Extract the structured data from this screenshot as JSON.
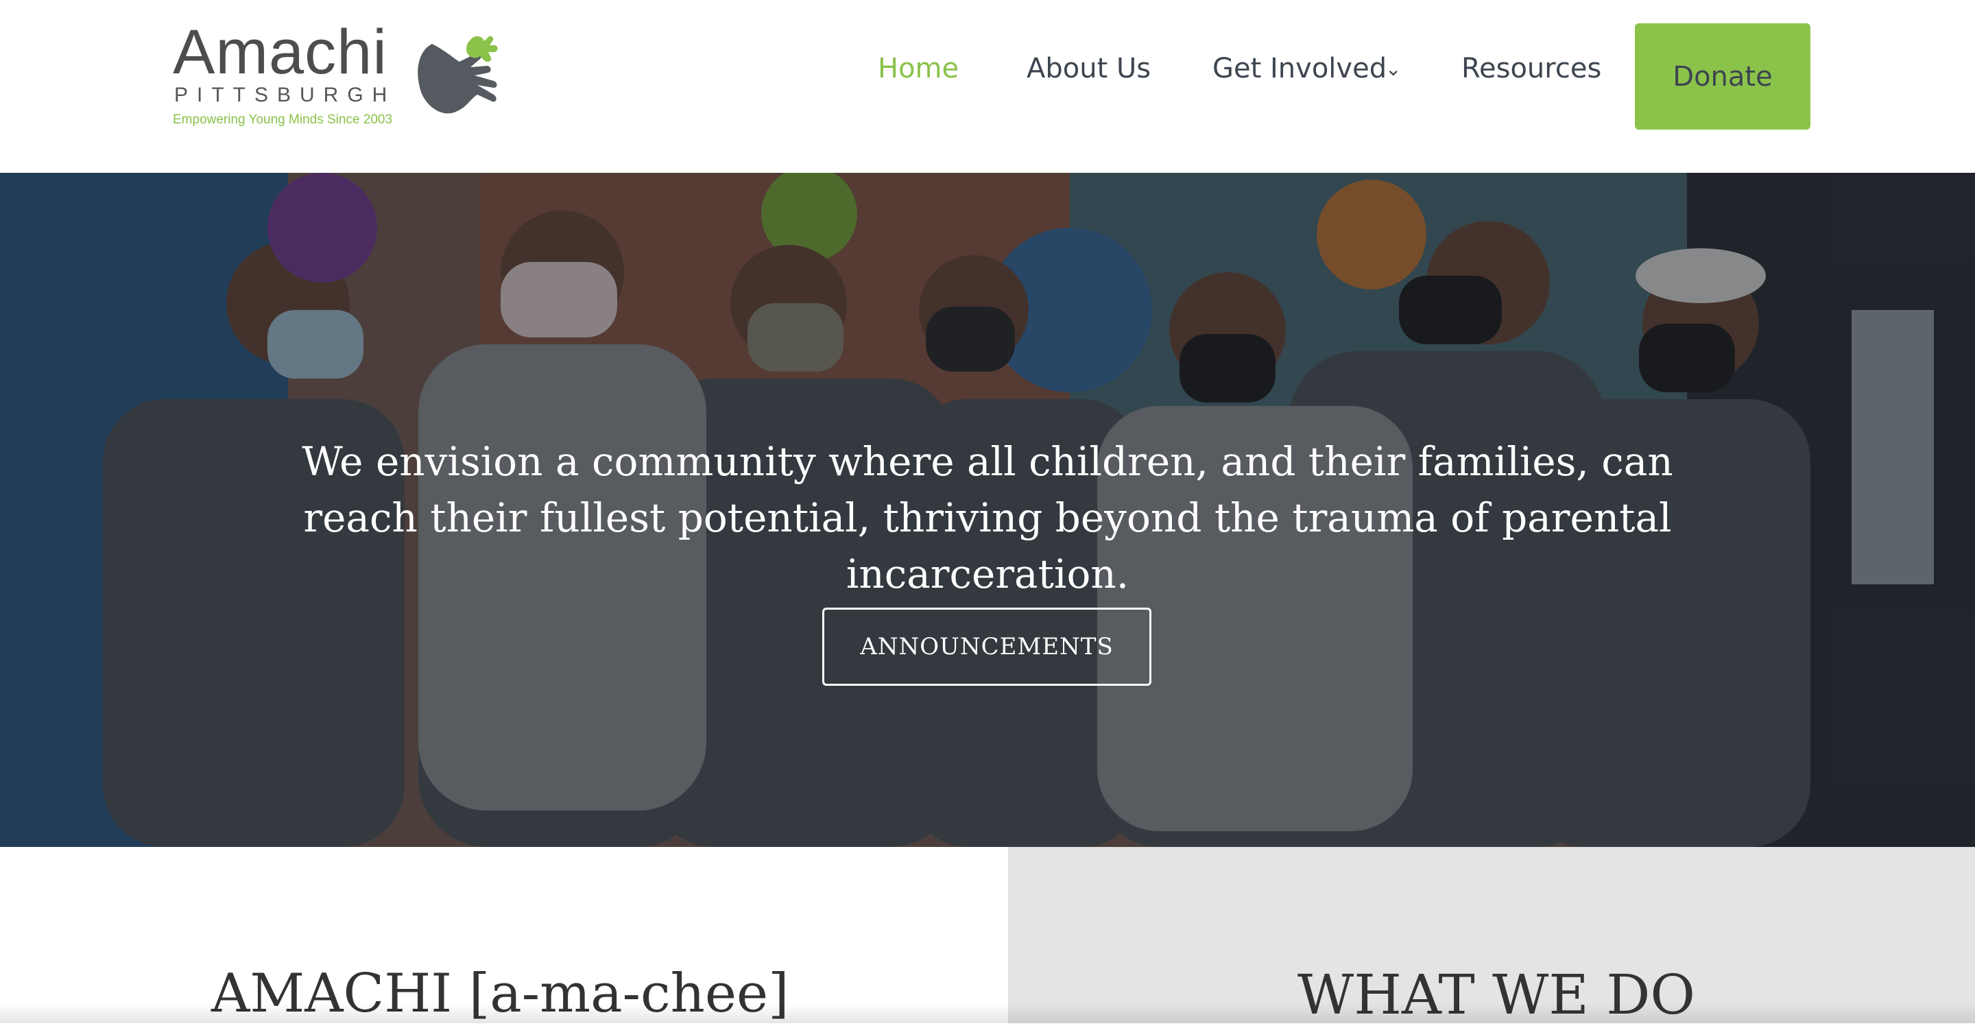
{
  "logo": {
    "name": "Amachi",
    "city": "PITTSBURGH",
    "tagline": "Empowering Young Minds Since 2003",
    "icon": "hands-logo-icon"
  },
  "nav": {
    "items": [
      {
        "label": "Home",
        "active": true
      },
      {
        "label": "About Us"
      },
      {
        "label": "Get Involved",
        "dropdown": true
      },
      {
        "label": "Resources"
      }
    ],
    "donate_label": "Donate",
    "chevron_icon": "chevron-down-icon"
  },
  "hero": {
    "line1": "We envision a community where all children, and their families, can",
    "line2": "reach their fullest potential, thriving beyond the trauma of parental incarceration.",
    "button_label": "ANNOUNCEMENTS",
    "image": "group-photo"
  },
  "sections": {
    "left_heading": "AMACHI [a-ma-chee]",
    "right_heading": "WHAT WE DO"
  },
  "colors": {
    "accent": "#8bc34a",
    "nav_text": "#3d4550",
    "panel_gray": "#e4e4e4",
    "heading": "#333333"
  }
}
